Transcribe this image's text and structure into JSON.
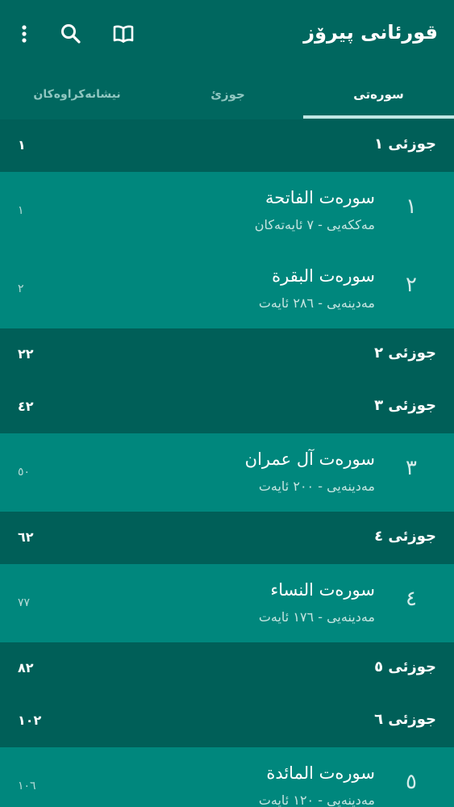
{
  "app": {
    "title": "قورئانی پیرۆز"
  },
  "toolbar": {
    "more_icon": "more-vert-icon",
    "search_icon": "search-icon",
    "book_icon": "open-book-icon"
  },
  "tabs": [
    {
      "label": "سورەتی",
      "active": true
    },
    {
      "label": "جوزئ",
      "active": false
    },
    {
      "label": "نیشانەکراوەکان",
      "active": false
    }
  ],
  "colors": {
    "appbar": "#00675f",
    "juz_row": "#005f58",
    "sura_row": "#00877d",
    "indicator": "#bfe7e3"
  },
  "list": [
    {
      "type": "juz",
      "label": "جوزئی ١",
      "page": "١"
    },
    {
      "type": "sura",
      "number": "١",
      "name": "سورەت الفاتحة",
      "info": "مەککەیی - ٧ ئایەتەکان",
      "page": "١"
    },
    {
      "type": "sura",
      "number": "٢",
      "name": "سورەت البقرة",
      "info": "مەدینەیی - ٢٨٦ ئایەت",
      "page": "٢"
    },
    {
      "type": "juz",
      "label": "جوزئی ٢",
      "page": "٢٢"
    },
    {
      "type": "juz",
      "label": "جوزئی ٣",
      "page": "٤٢"
    },
    {
      "type": "sura",
      "number": "٣",
      "name": "سورەت آل عمران",
      "info": "مەدینەیی - ٢٠٠ ئایەت",
      "page": "٥٠"
    },
    {
      "type": "juz",
      "label": "جوزئی ٤",
      "page": "٦٢"
    },
    {
      "type": "sura",
      "number": "٤",
      "name": "سورەت النساء",
      "info": "مەدینەیی - ١٧٦ ئایەت",
      "page": "٧٧"
    },
    {
      "type": "juz",
      "label": "جوزئی ٥",
      "page": "٨٢"
    },
    {
      "type": "juz",
      "label": "جوزئی ٦",
      "page": "١٠٢"
    },
    {
      "type": "sura",
      "number": "٥",
      "name": "سورەت المائدة",
      "info": "مەدینەیی - ١٢٠ ئایەت",
      "page": "١٠٦"
    }
  ]
}
